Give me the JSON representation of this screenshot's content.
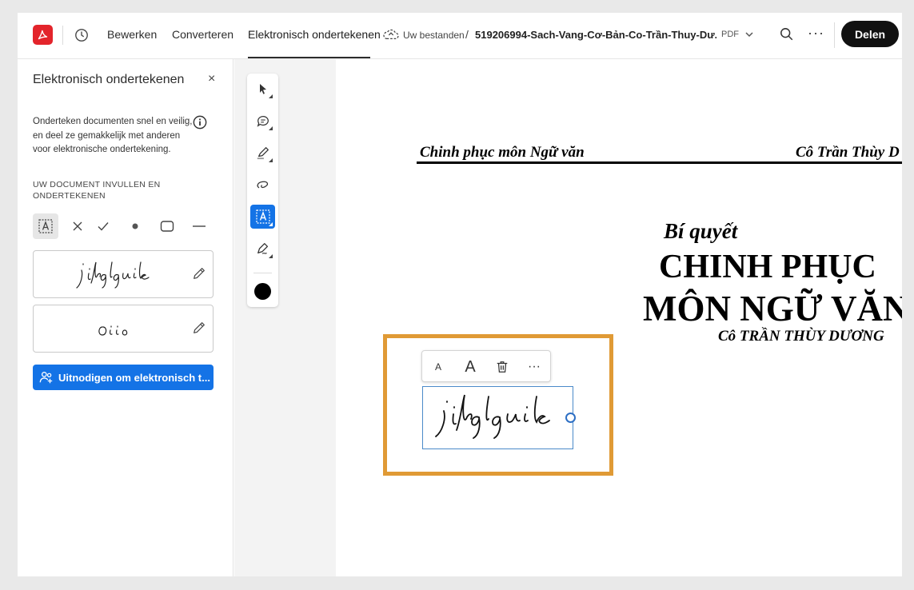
{
  "topbar": {
    "tabs": [
      {
        "label": "Bewerken"
      },
      {
        "label": "Converteren"
      },
      {
        "label": "Elektronisch ondertekenen"
      }
    ],
    "save_status": "Uw bestanden",
    "separator": "/",
    "filename": "519206994-Sach-Vang-Cơ-Bản-Co-Trần-Thuy-Dư...",
    "file_type": "PDF",
    "share_label": "Delen",
    "more_label": "···"
  },
  "panel": {
    "title": "Elektronisch ondertekenen",
    "close_label": "×",
    "description": "Onderteken documenten snel en veilig, en deel ze gemakkelijk met anderen voor elektronische ondertekening.",
    "section_heading": "UW DOCUMENT INVULLEN EN ONDERTEKENEN",
    "tools": [
      "text-field-icon",
      "cross-icon",
      "check-icon",
      "dot-icon",
      "rectangle-icon",
      "line-icon"
    ],
    "signatures": [
      {
        "name": "jikglguik"
      },
      {
        "name": "Oiio"
      }
    ],
    "invite_label": "Uitnodigen om elektronisch t..."
  },
  "vertical_toolbar": {
    "tools": [
      "select-icon",
      "comment-icon",
      "highlight-icon",
      "draw-icon",
      "fill-sign-icon",
      "sign-icon"
    ],
    "active_tool": "fill-sign-icon",
    "color": "#000000"
  },
  "document": {
    "header_left": "Chinh phục môn Ngữ văn",
    "header_right": "Cô Trần Thùy D",
    "title_small": "Bí quyết",
    "title_line1": "CHINH PHỤC",
    "title_line2": "MÔN NGỮ VĂN",
    "author": "Cô TRẦN THÙY DƯƠNG",
    "placed_signature": "jikglguik",
    "mini_toolbar": {
      "small_a": "A",
      "large_a": "A",
      "more": "···"
    }
  },
  "colors": {
    "accent": "#1473e6",
    "highlight": "#e09a35",
    "logo": "#e3242b"
  }
}
